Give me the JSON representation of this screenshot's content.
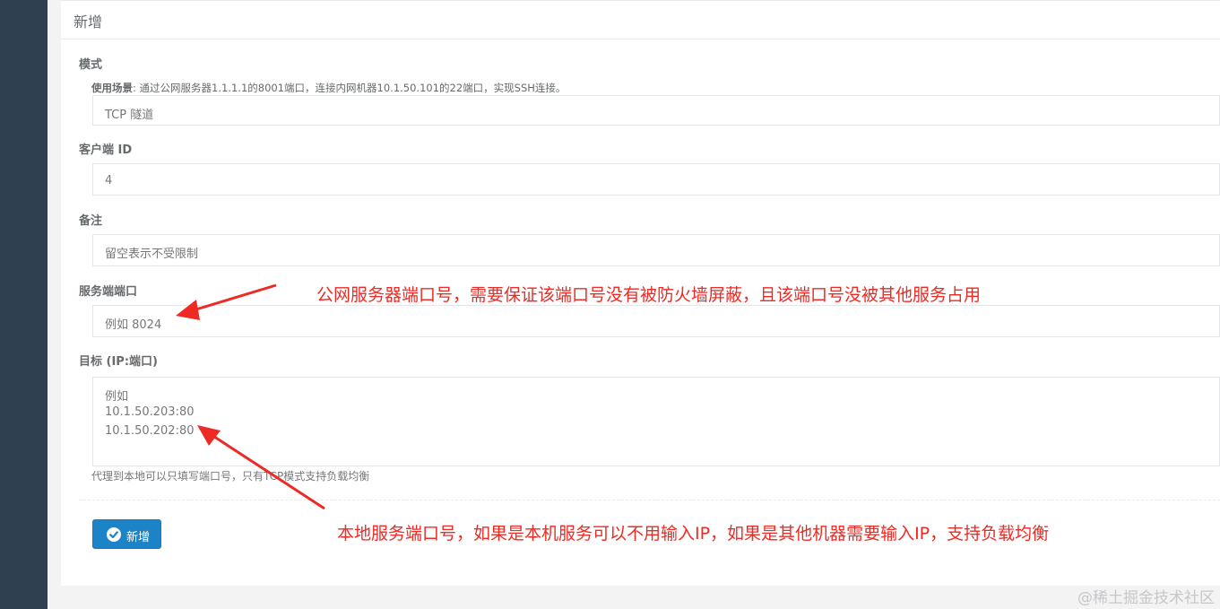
{
  "page": {
    "title": "新增"
  },
  "form": {
    "mode": {
      "label": "模式",
      "hint_bold": "使用场景",
      "hint_text": ": 通过公网服务器1.1.1.1的8001端口，连接内网机器10.1.50.101的22端口，实现SSH连接。",
      "value": "TCP 隧道"
    },
    "client_id": {
      "label": "客户端 ID",
      "value": "4"
    },
    "remark": {
      "label": "备注",
      "placeholder": "留空表示不受限制"
    },
    "server_port": {
      "label": "服务端端口",
      "placeholder": "例如 8024"
    },
    "target": {
      "label": "目标 (IP:端口)",
      "placeholder_lines": [
        "例如",
        "10.1.50.203:80",
        "10.1.50.202:80"
      ],
      "help": "代理到本地可以只填写端口号，只有TCP模式支持负载均衡"
    },
    "submit": {
      "label": "新增",
      "icon": "check-circle-icon"
    }
  },
  "annotations": {
    "server_port_note": "公网服务器端口号，需要保证该端口号没有被防火墙屏蔽，且该端口号没被其他服务占用",
    "target_note": "本地服务端口号，如果是本机服务可以不用输入IP，如果是其他机器需要输入IP，支持负载均衡"
  },
  "watermark": "@稀土掘金技术社区",
  "colors": {
    "sidebar": "#2f4050",
    "primary_button": "#1c84c6",
    "annotation": "#ee2a24"
  }
}
